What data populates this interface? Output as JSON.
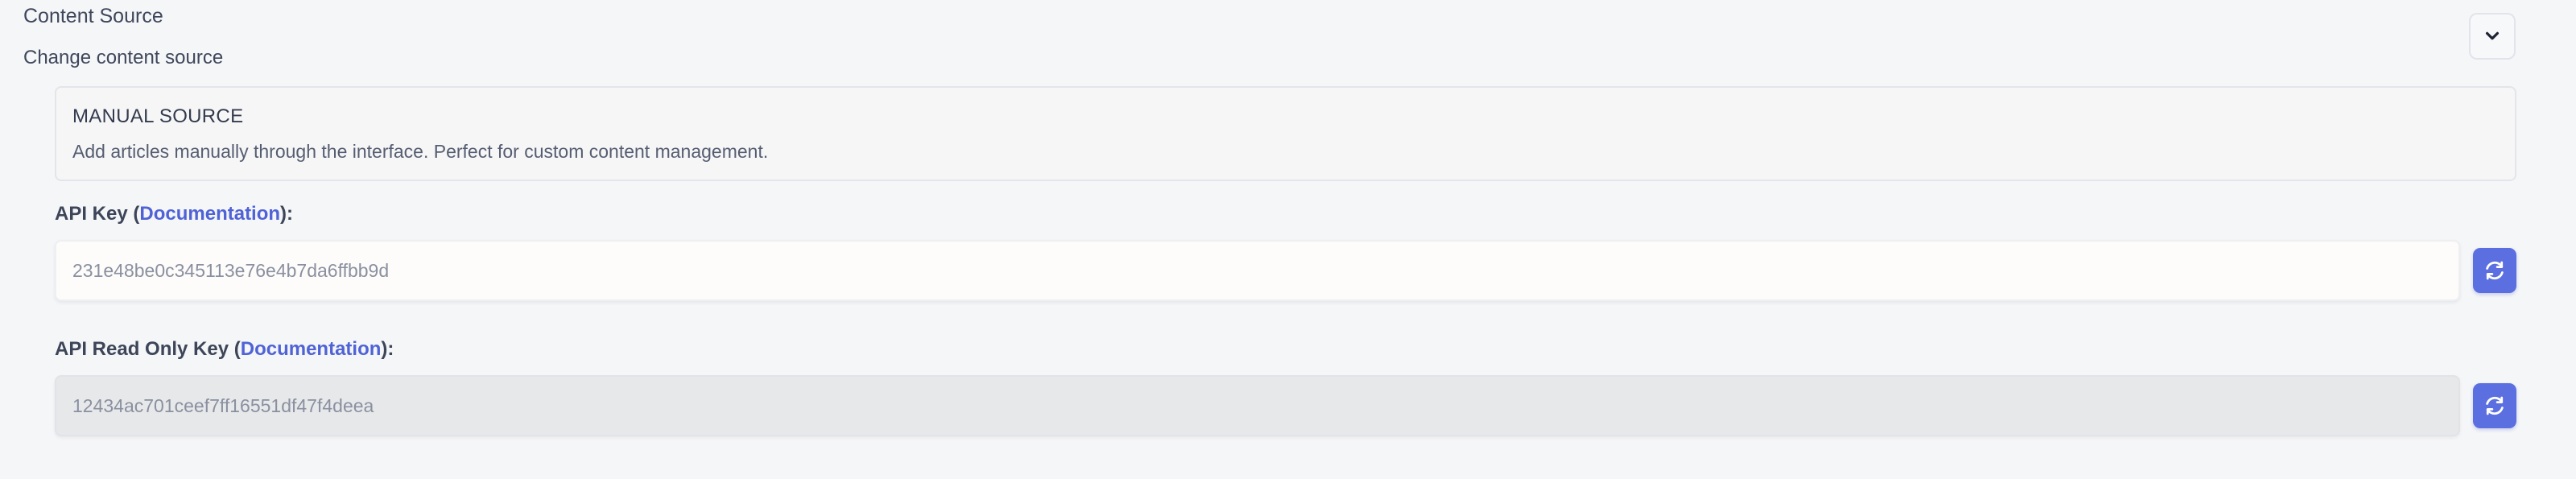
{
  "section": {
    "title": "Content Source",
    "subtitle": "Change content source"
  },
  "icons": {
    "collapse": "chevron-down-icon",
    "regenerate": "refresh-icon"
  },
  "source_card": {
    "title": "MANUAL SOURCE",
    "description": "Add articles manually through the interface. Perfect for custom content management."
  },
  "api_key": {
    "label_prefix": "API Key (",
    "link_text": "Documentation",
    "label_suffix": "):",
    "value": "231e48be0c345113e76e4b7da6ffbb9d"
  },
  "api_read_only_key": {
    "label_prefix": "API Read Only Key (",
    "link_text": "Documentation",
    "label_suffix": "):",
    "value": "12434ac701ceef7ff16551df47f4deea"
  },
  "colors": {
    "accent": "#5b6fe0",
    "link": "#4f63d6",
    "background": "#f5f6f8",
    "readonly_field": "#e7e8ea"
  }
}
